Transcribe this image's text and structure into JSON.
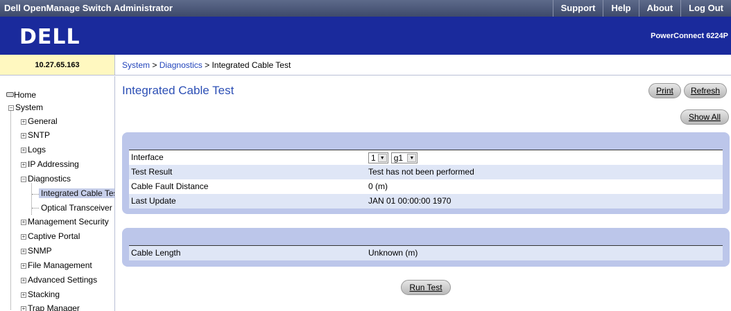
{
  "app": {
    "title": "Dell OpenManage Switch Administrator"
  },
  "top_links": [
    "Support",
    "Help",
    "About",
    "Log Out"
  ],
  "brand": {
    "logo": "DELL",
    "model": "PowerConnect 6224P"
  },
  "device_ip": "10.27.65.163",
  "breadcrumb": {
    "system": "System",
    "diagnostics": "Diagnostics",
    "sep": ">",
    "current": "Integrated Cable Test"
  },
  "sidebar": {
    "home": "Home",
    "system": "System",
    "general": "General",
    "sntp": "SNTP",
    "logs": "Logs",
    "ip_addressing": "IP Addressing",
    "diagnostics": "Diagnostics",
    "integrated_cable_test": "Integrated Cable Test",
    "optical_transceiver": "Optical Transceiver",
    "management_security": "Management Security",
    "captive_portal": "Captive Portal",
    "snmp": "SNMP",
    "file_management": "File Management",
    "advanced_settings": "Advanced Settings",
    "stacking": "Stacking",
    "trap_manager": "Trap Manager"
  },
  "page": {
    "title": "Integrated Cable Test"
  },
  "buttons": {
    "print": "Print",
    "refresh": "Refresh",
    "show_all": "Show All",
    "run_test": "Run Test"
  },
  "test": {
    "interface_label": "Interface",
    "unit": "1",
    "port": "g1",
    "result_label": "Test Result",
    "result_value": "Test has not been performed",
    "fault_label": "Cable Fault Distance",
    "fault_value": "0  (m)",
    "update_label": "Last Update",
    "update_value": "JAN 01 00:00:00 1970"
  },
  "cable": {
    "length_label": "Cable Length",
    "length_value": "Unknown  (m)"
  }
}
